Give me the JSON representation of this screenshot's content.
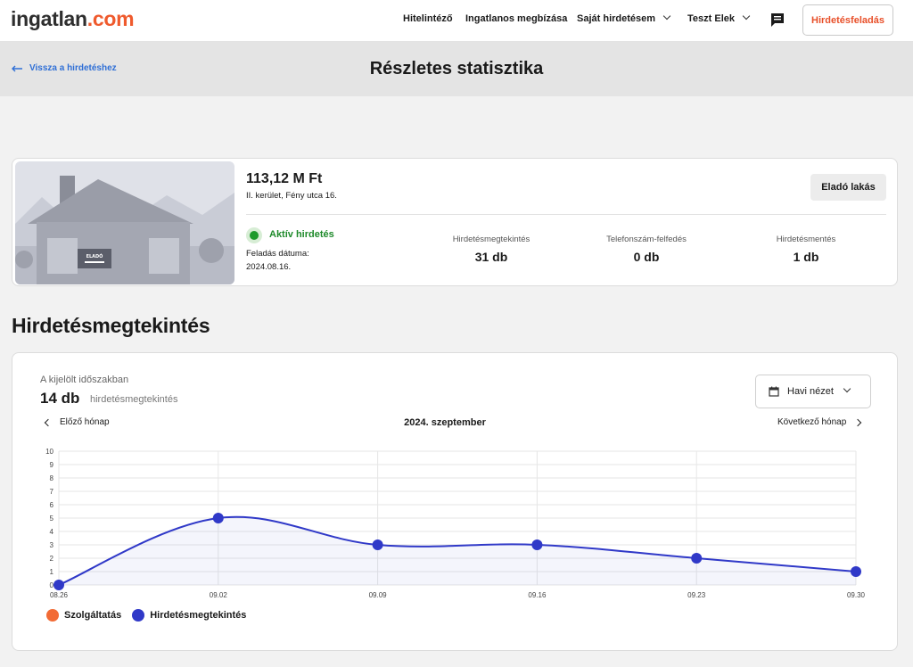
{
  "header": {
    "logo_part1": "ingatlan",
    "logo_part2": ".com",
    "nav": {
      "credit": "Hitelintéző",
      "agent": "Ingatlanos megbízása",
      "my_ads": "Saját hirdetésem",
      "user": "Teszt Elek"
    },
    "post_button": "Hirdetésfeladás",
    "icons": [
      "chat-icon",
      "chevron-down-icon"
    ]
  },
  "subheader": {
    "back_label": "Vissza a hirdetéshez",
    "title": "Részletes statisztika"
  },
  "listing": {
    "price": "113,12 M Ft",
    "address": "II. kerület, Fény utca 16.",
    "type_badge": "Eladó lakás",
    "sign_text": "ELADÓ",
    "status": "Aktív hirdetés",
    "posted_label": "Feladás dátuma:",
    "posted_date": "2024.08.16.",
    "stats": [
      {
        "label": "Hirdetésmegtekintés",
        "value": "31 db"
      },
      {
        "label": "Telefonszám-felfedés",
        "value": "0 db"
      },
      {
        "label": "Hirdetésmentés",
        "value": "1 db"
      }
    ]
  },
  "section": {
    "title": "Hirdetésmegtekintés"
  },
  "chart_panel": {
    "period_label": "A kijelölt időszakban",
    "count": "14 db",
    "count_unit": "hirdetésmegtekintés",
    "view_select": "Havi nézet",
    "prev": "Előző hónap",
    "next": "Következő hónap",
    "month": "2024. szeptember"
  },
  "chart_data": {
    "type": "line",
    "x": [
      "08.26",
      "09.02",
      "09.09",
      "09.16",
      "09.23",
      "09.30"
    ],
    "ylim": [
      0,
      10
    ],
    "yticks": [
      "0",
      "1",
      "2",
      "3",
      "4",
      "5",
      "6",
      "7",
      "8",
      "9",
      "10"
    ],
    "grid": true,
    "legend_position": "bottom-left",
    "series": [
      {
        "name": "Szolgáltatás",
        "color": "#f26b35",
        "values": []
      },
      {
        "name": "Hirdetésmegtekintés",
        "color": "#3039c8",
        "values": [
          0,
          5,
          3,
          3,
          2,
          1
        ]
      }
    ]
  }
}
